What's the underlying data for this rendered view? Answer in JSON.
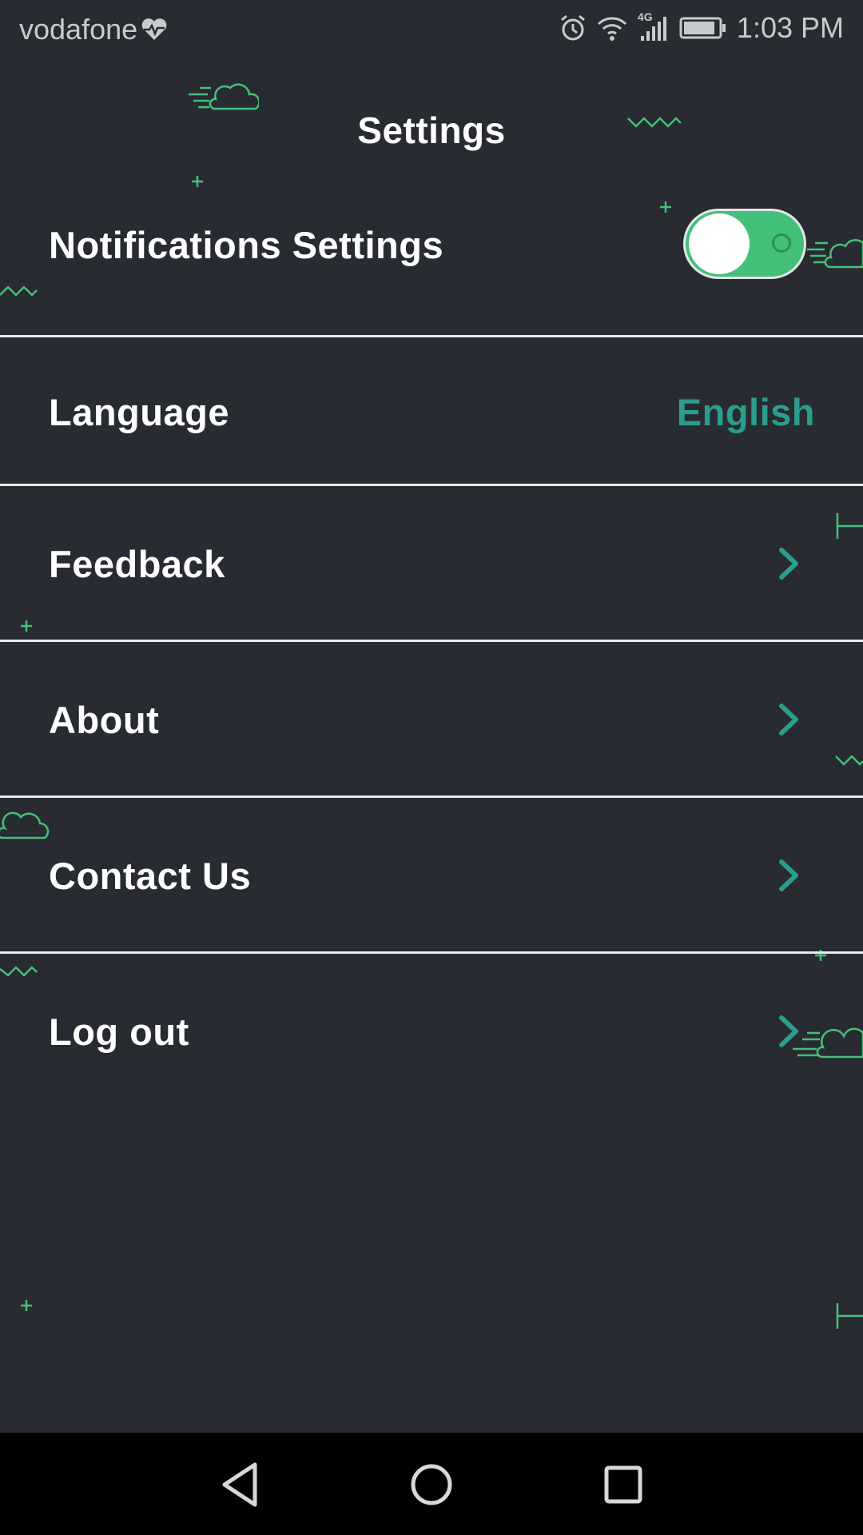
{
  "status_bar": {
    "carrier": "vodafone",
    "network": "4G",
    "time": "1:03 PM"
  },
  "header": {
    "title": "Settings"
  },
  "settings": {
    "notifications": {
      "label": "Notifications Settings",
      "enabled": true
    },
    "language": {
      "label": "Language",
      "value": "English"
    },
    "feedback": {
      "label": "Feedback"
    },
    "about": {
      "label": "About"
    },
    "contact": {
      "label": "Contact Us"
    },
    "logout": {
      "label": "Log out"
    }
  },
  "colors": {
    "background": "#282b31",
    "accent_teal": "#2a9d8f",
    "accent_green": "#43c07a",
    "text": "#ffffff"
  },
  "nav_bar": {
    "icons": [
      "back-icon",
      "home-icon",
      "recents-icon"
    ]
  }
}
